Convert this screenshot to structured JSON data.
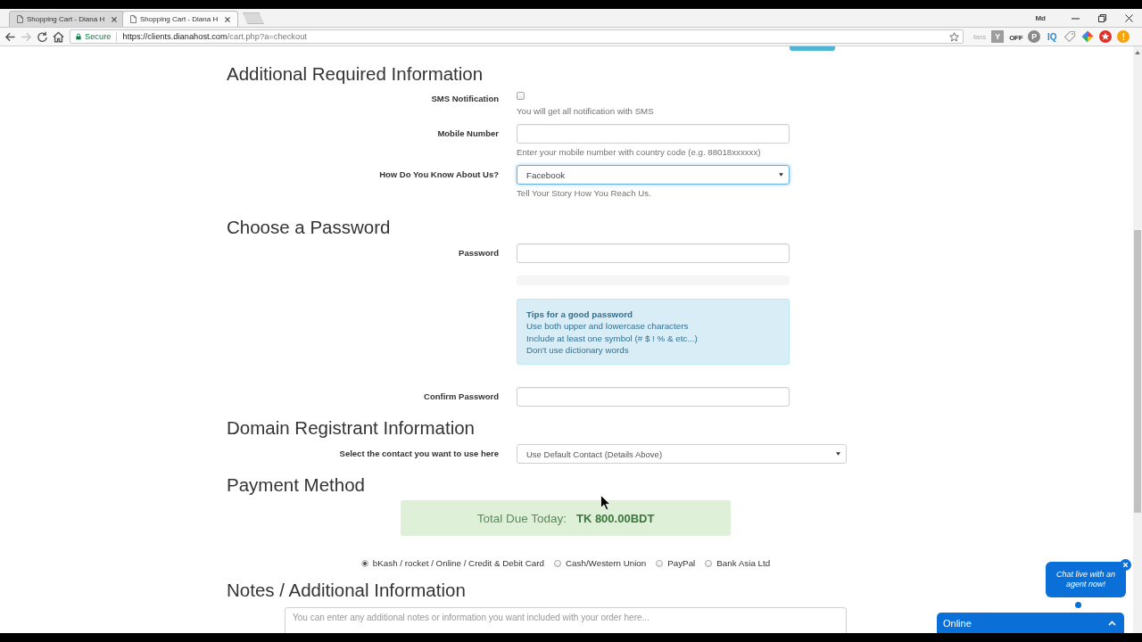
{
  "browser": {
    "tabs": [
      {
        "title": "Shopping Cart - Diana H",
        "selected": false
      },
      {
        "title": "Shopping Cart - Diana H",
        "selected": true
      }
    ],
    "profile": "Md",
    "nav_buttons": [
      {
        "kind": "back",
        "disabled": false
      },
      {
        "kind": "forward",
        "disabled": true
      },
      {
        "kind": "reload",
        "disabled": false
      },
      {
        "kind": "home",
        "disabled": false
      }
    ],
    "address": {
      "secure_label": "Secure",
      "host": "https://clients.dianahost.com",
      "path": "/cart.php?a=checkout",
      "bookmarked": false
    },
    "extensions": [
      {
        "kind": "faint",
        "label": "fans"
      },
      {
        "kind": "tile",
        "label": "Y"
      },
      {
        "kind": "off",
        "label": "OFF"
      },
      {
        "kind": "disc",
        "label": "P"
      },
      {
        "kind": "brand",
        "label": "IQ"
      },
      {
        "kind": "tag"
      },
      {
        "kind": "diamond"
      },
      {
        "kind": "star"
      },
      {
        "kind": "alert",
        "label": "!"
      }
    ]
  },
  "page": {
    "sections": [
      {
        "heading": "Additional Required Information",
        "fields": [
          {
            "kind": "checkbox",
            "label": "SMS Notification",
            "checked": false,
            "help": "You will get all notification with SMS"
          },
          {
            "kind": "text",
            "label": "Mobile Number",
            "focused": false,
            "help": "Enter your mobile number with country code (e.g. 88018xxxxxx)"
          },
          {
            "kind": "select",
            "label": "How Do You Know About Us?",
            "value": "Facebook",
            "focused": true,
            "help": "Tell Your Story How You Reach Us."
          }
        ]
      },
      {
        "heading": "Choose a Password",
        "fields": [
          {
            "kind": "password",
            "label": "Password",
            "focused": false
          },
          {
            "kind": "strength",
            "level": 0
          },
          {
            "kind": "tips",
            "title": "Tips for a good password",
            "lines": [
              "Use both upper and lowercase characters",
              "Include at least one symbol (# $ ! % & etc...)",
              "Don't use dictionary words"
            ]
          },
          {
            "kind": "password",
            "label": "Confirm Password",
            "focused": false
          }
        ]
      },
      {
        "heading": "Domain Registrant Information",
        "fields": [
          {
            "kind": "wideselect",
            "label": "Select the contact you want to use here",
            "value": "Use Default Contact (Details Above)",
            "focused": false
          }
        ]
      },
      {
        "heading": "Payment Method",
        "fields": [
          {
            "kind": "total",
            "label": "Total Due Today:",
            "amount": "TK 800.00BDT"
          },
          {
            "kind": "radios",
            "options": [
              {
                "label": "bKash / rocket / Online / Credit & Debit Card",
                "selected": true
              },
              {
                "label": "Cash/Western Union",
                "selected": false
              },
              {
                "label": "PayPal",
                "selected": false
              },
              {
                "label": "Bank Asia Ltd",
                "selected": false
              }
            ]
          }
        ]
      },
      {
        "heading": "Notes / Additional Information",
        "fields": [
          {
            "kind": "textarea",
            "placeholder": "You can enter any additional notes or information you want included with your order here...",
            "focused": false
          }
        ]
      }
    ]
  },
  "chat": {
    "prompt": "Chat live with an agent now!",
    "status": "Online"
  }
}
